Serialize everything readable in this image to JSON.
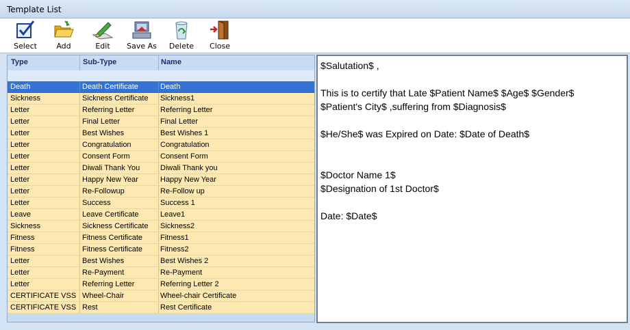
{
  "window": {
    "title": "Template List"
  },
  "toolbar": {
    "buttons": [
      {
        "label": "Select",
        "icon": "select-checkbox-icon"
      },
      {
        "label": "Add",
        "icon": "folder-open-icon"
      },
      {
        "label": "Edit",
        "icon": "pencil-edit-icon"
      },
      {
        "label": "Save As",
        "icon": "save-as-computer-icon"
      },
      {
        "label": "Delete",
        "icon": "recycle-bin-icon"
      },
      {
        "label": "Close",
        "icon": "exit-door-icon"
      }
    ]
  },
  "grid": {
    "columns": [
      "Type",
      "Sub-Type",
      "Name"
    ],
    "selected_index": 0,
    "rows": [
      [
        "Death",
        "Death Certificate",
        "Death"
      ],
      [
        "Sickness",
        "Sickness Certificate",
        "Sickness1"
      ],
      [
        "Letter",
        "Referring Letter",
        "Referring Letter"
      ],
      [
        "Letter",
        "Final Letter",
        "Final Letter"
      ],
      [
        "Letter",
        "Best Wishes",
        "Best Wishes 1"
      ],
      [
        "Letter",
        "Congratulation",
        "Congratulation"
      ],
      [
        "Letter",
        "Consent Form",
        "Consent Form"
      ],
      [
        "Letter",
        "Diwali Thank You",
        "Diwali Thank you"
      ],
      [
        "Letter",
        "Happy New Year",
        "Happy New Year"
      ],
      [
        "Letter",
        "Re-Followup",
        "Re-Follow  up"
      ],
      [
        "Letter",
        "Success",
        "Success 1"
      ],
      [
        "Leave",
        "Leave Certificate",
        "Leave1"
      ],
      [
        "Sickness",
        "Sickness Certificate",
        "Sickness2"
      ],
      [
        "Fitness",
        "Fitness Certificate",
        "Fitness1"
      ],
      [
        "Fitness",
        "Fitness Certificate",
        "Fitness2"
      ],
      [
        "Letter",
        "Best Wishes",
        "Best Wishes 2"
      ],
      [
        "Letter",
        "Re-Payment",
        "Re-Payment"
      ],
      [
        "Letter",
        "Referring Letter",
        "Referring Letter 2"
      ],
      [
        "CERTIFICATE VSS",
        "Wheel-Chair",
        "Wheel-chair Certificate"
      ],
      [
        "CERTIFICATE VSS",
        "Rest",
        "Rest Certificate"
      ]
    ]
  },
  "preview": {
    "lines": [
      "$Salutation$ ,",
      "This is to certify that Late $Patient Name$  $Age$  $Gender$",
      "$Patient's City$ ,suffering from  $Diagnosis$",
      "$He/She$ was Expired on Date:  $Date of Death$",
      "$Doctor Name 1$",
      "$Designation of 1st Doctor$",
      "Date: $Date$"
    ]
  },
  "colors": {
    "selected_row": "#3472d4",
    "row_bg": "#fde8b2",
    "panel_bg": "#c7dcf1"
  }
}
